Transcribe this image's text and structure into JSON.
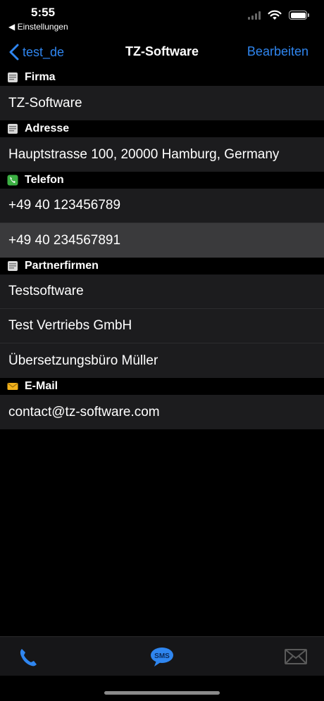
{
  "status": {
    "time": "5:55",
    "back_app": "◀ Einstellungen"
  },
  "nav": {
    "back_label": "test_de",
    "title": "TZ-Software",
    "edit_label": "Bearbeiten"
  },
  "sections": {
    "firma": {
      "title": "Firma",
      "rows": [
        "TZ-Software"
      ]
    },
    "adresse": {
      "title": "Adresse",
      "rows": [
        "Hauptstrasse 100, 20000 Hamburg, Germany"
      ]
    },
    "telefon": {
      "title": "Telefon",
      "rows": [
        "+49 40 123456789",
        "+49 40 234567891"
      ]
    },
    "partnerfirmen": {
      "title": "Partnerfirmen",
      "rows": [
        "Testsoftware",
        "Test Vertriebs GmbH",
        "Übersetzungsbüro Müller"
      ]
    },
    "email": {
      "title": "E-Mail",
      "rows": [
        "contact@tz-software.com"
      ]
    }
  },
  "toolbar": {
    "sms_label": "SMS"
  },
  "colors": {
    "accent": "#2f86f0",
    "row_bg": "#1c1c1e",
    "row_selected_bg": "#3a3a3c"
  }
}
